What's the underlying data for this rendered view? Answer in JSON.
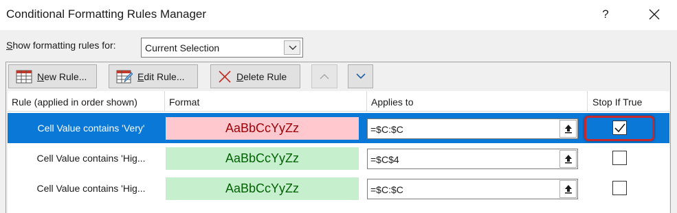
{
  "window": {
    "title": "Conditional Formatting Rules Manager",
    "help_label": "?"
  },
  "show_rules": {
    "label_accel": "S",
    "label_rest": "how formatting rules for:",
    "selected": "Current Selection"
  },
  "toolbar": {
    "new_accel": "N",
    "new_rest": "ew Rule...",
    "edit_accel": "E",
    "edit_rest": "dit Rule...",
    "delete_accel": "D",
    "delete_rest": "elete Rule"
  },
  "columns": {
    "rule": "Rule (applied in order shown)",
    "format": "Format",
    "applies_to": "Applies to",
    "stop_if_true": "Stop If True"
  },
  "rules": [
    {
      "name": "Cell Value contains 'Very'",
      "preview": "AaBbCcYyZz",
      "applies_to": "=$C:$C",
      "stop_if_true": true
    },
    {
      "name": "Cell Value contains 'Hig...",
      "preview": "AaBbCcYyZz",
      "applies_to": "=$C$4",
      "stop_if_true": false
    },
    {
      "name": "Cell Value contains 'Hig...",
      "preview": "AaBbCcYyZz",
      "applies_to": "=$C:$C",
      "stop_if_true": false
    }
  ],
  "colors": {
    "selection": "#0a78d7",
    "red_fill": "#ffc7ce",
    "red_text": "#9c0006",
    "green_fill": "#c6efce",
    "green_text": "#006100",
    "highlight": "#c6282e"
  }
}
